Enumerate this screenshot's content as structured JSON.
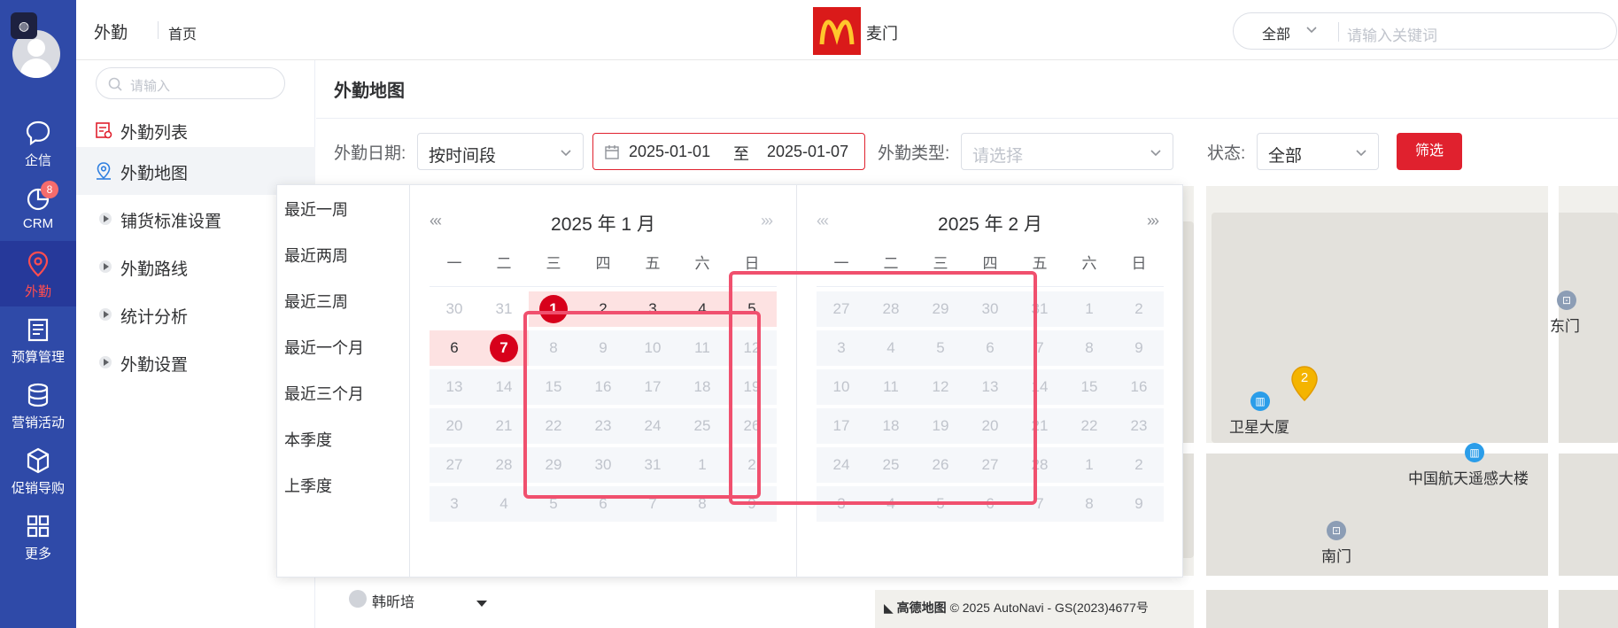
{
  "rail": {
    "top_icon": "brain-icon",
    "items": [
      {
        "label": "企信",
        "icon": "chat-bubble-icon"
      },
      {
        "label": "CRM",
        "icon": "pie-chart-icon",
        "badge": "8"
      },
      {
        "label": "外勤",
        "icon": "location-pin-icon"
      },
      {
        "label": "预算管理",
        "icon": "budget-icon"
      },
      {
        "label": "营销活动",
        "icon": "database-icon"
      },
      {
        "label": "促销导购",
        "icon": "cube-icon"
      },
      {
        "label": "更多",
        "icon": "grid-icon"
      }
    ],
    "active_color": "#ff4d4f"
  },
  "header": {
    "module": "外勤",
    "home": "首页",
    "brand_name": "麦门",
    "search": {
      "scope": "全部",
      "placeholder": "请输入关键词"
    }
  },
  "sidebar": {
    "search_placeholder": "请输入",
    "items": [
      {
        "label": "外勤列表",
        "icon": "list-icon"
      },
      {
        "label": "外勤地图",
        "icon": "map-pin-icon",
        "active": true
      },
      {
        "label": "铺货标准设置"
      },
      {
        "label": "外勤路线"
      },
      {
        "label": "统计分析"
      },
      {
        "label": "外勤设置"
      }
    ]
  },
  "main": {
    "title": "外勤地图",
    "filters": {
      "date_label": "外勤日期:",
      "date_mode": "按时间段",
      "range_start": "2025-01-01",
      "range_sep": "至",
      "range_end": "2025-01-07",
      "type_label": "外勤类型:",
      "type_placeholder": "请选择",
      "status_label": "状态:",
      "status_value": "全部",
      "filter_button": "筛选"
    }
  },
  "picker": {
    "shortcuts": [
      "最近一周",
      "最近两周",
      "最近三周",
      "最近一个月",
      "最近三个月",
      "本季度",
      "上季度"
    ],
    "weekdays": [
      "一",
      "二",
      "三",
      "四",
      "五",
      "六",
      "日"
    ],
    "left": {
      "title": "2025 年 1 月",
      "nav": "«‹",
      "rows": [
        [
          "30",
          "31",
          "1",
          "2",
          "3",
          "4",
          "5"
        ],
        [
          "6",
          "7",
          "8",
          "9",
          "10",
          "11",
          "12"
        ],
        [
          "13",
          "14",
          "15",
          "16",
          "17",
          "18",
          "19"
        ],
        [
          "20",
          "21",
          "22",
          "23",
          "24",
          "25",
          "26"
        ],
        [
          "27",
          "28",
          "29",
          "30",
          "31",
          "1",
          "2"
        ],
        [
          "3",
          "4",
          "5",
          "6",
          "7",
          "8",
          "9"
        ]
      ]
    },
    "right": {
      "title": "2025 年 2 月",
      "nav": "›»",
      "rows": [
        [
          "27",
          "28",
          "29",
          "30",
          "31",
          "1",
          "2"
        ],
        [
          "3",
          "4",
          "5",
          "6",
          "7",
          "8",
          "9"
        ],
        [
          "10",
          "11",
          "12",
          "13",
          "14",
          "15",
          "16"
        ],
        [
          "17",
          "18",
          "19",
          "20",
          "21",
          "22",
          "23"
        ],
        [
          "24",
          "25",
          "26",
          "27",
          "28",
          "1",
          "2"
        ],
        [
          "3",
          "4",
          "5",
          "6",
          "7",
          "8",
          "9"
        ]
      ]
    },
    "accent": "#d7001b"
  },
  "map": {
    "pois": [
      "卫星大厦",
      "中国航天遥感大楼",
      "东门",
      "南门"
    ],
    "marker_count": "2",
    "gate_icon": "gate-icon",
    "logo_text": "高德地图",
    "copyright": "© 2025 AutoNavi - GS(2023)4677号"
  },
  "bottom_user": "韩昕培"
}
